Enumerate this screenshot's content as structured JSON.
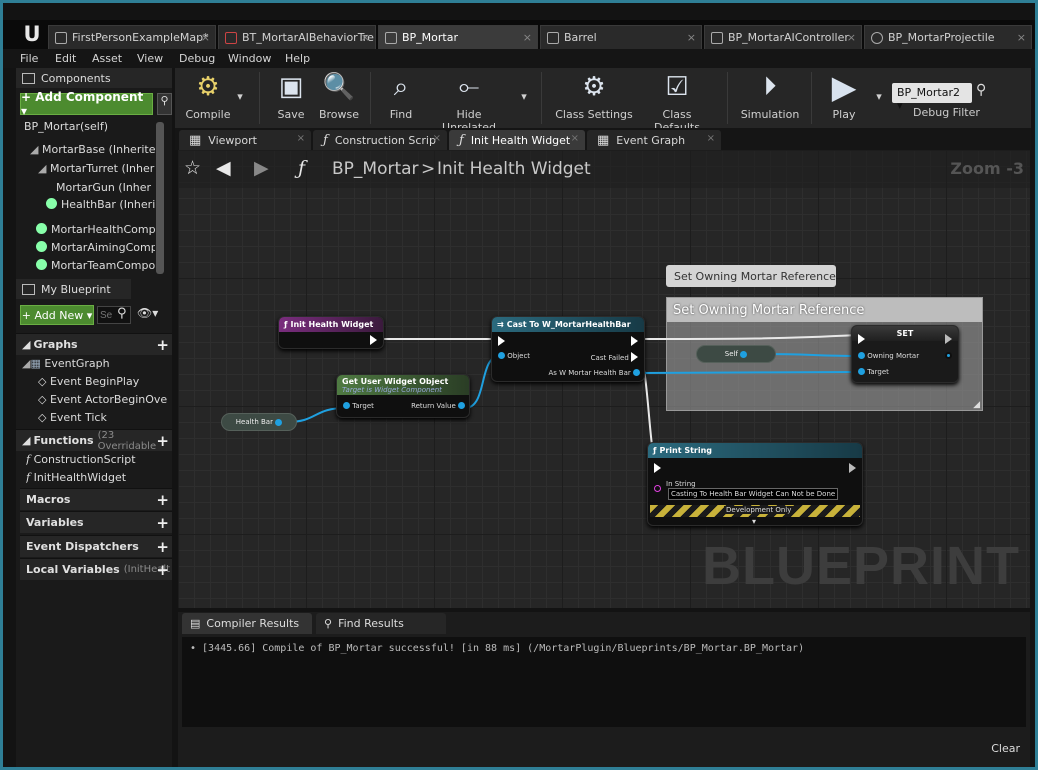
{
  "doc_tabs": [
    {
      "label": "FirstPersonExampleMap*",
      "icon": "level-icon",
      "active": false
    },
    {
      "label": "BT_MortarAIBehaviorTre",
      "icon": "behavior-tree-icon",
      "active": false
    },
    {
      "label": "BP_Mortar",
      "icon": "blueprint-icon",
      "active": true
    },
    {
      "label": "Barrel",
      "icon": "blueprint-icon",
      "active": false
    },
    {
      "label": "BP_MortarAIController",
      "icon": "blueprint-icon",
      "active": false
    },
    {
      "label": "BP_MortarProjectile",
      "icon": "blueprint-icon",
      "active": false
    }
  ],
  "menu": [
    "File",
    "Edit",
    "Asset",
    "View",
    "Debug",
    "Window",
    "Help"
  ],
  "components": {
    "header": "Components",
    "add_button": "+ Add Component ▾",
    "root": "BP_Mortar(self)",
    "items": [
      "MortarBase (Inherite",
      "MortarTurret (Inher",
      "MortarGun (Inher",
      "HealthBar (Inherite",
      "MortarHealthCompor",
      "MortarAimingCompo",
      "MortarTeamCompon"
    ]
  },
  "my_blueprint": {
    "header": "My Blueprint",
    "add_button": "+ Add New ▾",
    "search_placeholder": "Se",
    "graphs_label": "Graphs",
    "event_graph": "EventGraph",
    "events": [
      "Event BeginPlay",
      "Event ActorBeginOve",
      "Event Tick"
    ],
    "functions_label": "Functions",
    "functions_note": "(23 Overridable",
    "functions": [
      "ConstructionScript",
      "InitHealthWidget"
    ],
    "macros_label": "Macros",
    "variables_label": "Variables",
    "dispatchers_label": "Event Dispatchers",
    "local_vars_label": "Local Variables",
    "local_vars_note": "(InitHealt"
  },
  "toolbar": {
    "compile": "Compile",
    "save": "Save",
    "browse": "Browse",
    "find": "Find",
    "hide_unrelated": "Hide Unrelated",
    "class_settings": "Class Settings",
    "class_defaults": "Class Defaults",
    "simulation": "Simulation",
    "play": "Play",
    "debug_select": "BP_Mortar2",
    "debug_filter": "Debug Filter"
  },
  "editor_tabs": [
    "Viewport",
    "Construction Scrip",
    "Init Health Widget",
    "Event Graph"
  ],
  "graph": {
    "breadcrumb_root": "BP_Mortar",
    "breadcrumb_sep": ">",
    "breadcrumb_current": "Init Health Widget",
    "zoom": "Zoom -3",
    "watermark": "BLUEPRINT",
    "comment_bubble": "Set Owning Mortar Reference",
    "comment_title": "Set Owning Mortar Reference",
    "nodes": {
      "entry": "Init Health Widget",
      "get_widget": "Get User Widget Object",
      "get_widget_sub": "Target is Widget Component",
      "get_widget_target": "Target",
      "get_widget_return": "Return Value",
      "health_bar": "Health Bar",
      "cast": "Cast To W_MortarHealthBar",
      "cast_object": "Object",
      "cast_failed": "Cast Failed",
      "cast_as": "As W Mortar Health Bar",
      "self": "Self",
      "set": "SET",
      "set_owning": "Owning Mortar",
      "set_target": "Target",
      "print": "Print String",
      "print_in": "In String",
      "print_value": "Casting To Health Bar Widget Can Not be Done",
      "print_dev": "Development Only"
    }
  },
  "results": {
    "tabs": [
      "Compiler Results",
      "Find Results"
    ],
    "log": "•  [3445.66] Compile of BP_Mortar successful! [in 88 ms] (/MortarPlugin/Blueprints/BP_Mortar.BP_Mortar)",
    "clear": "Clear"
  },
  "colors": {
    "accent_border": "#2f7f96",
    "green_button": "#4c8b2f",
    "function_node": "#6a2a6e",
    "cast_node": "#1f4a5a",
    "getter_node": "#3e5f36",
    "print_node": "#1f4a5a",
    "exec_wire": "#e8e8e8",
    "object_wire": "#1fa0e0"
  }
}
